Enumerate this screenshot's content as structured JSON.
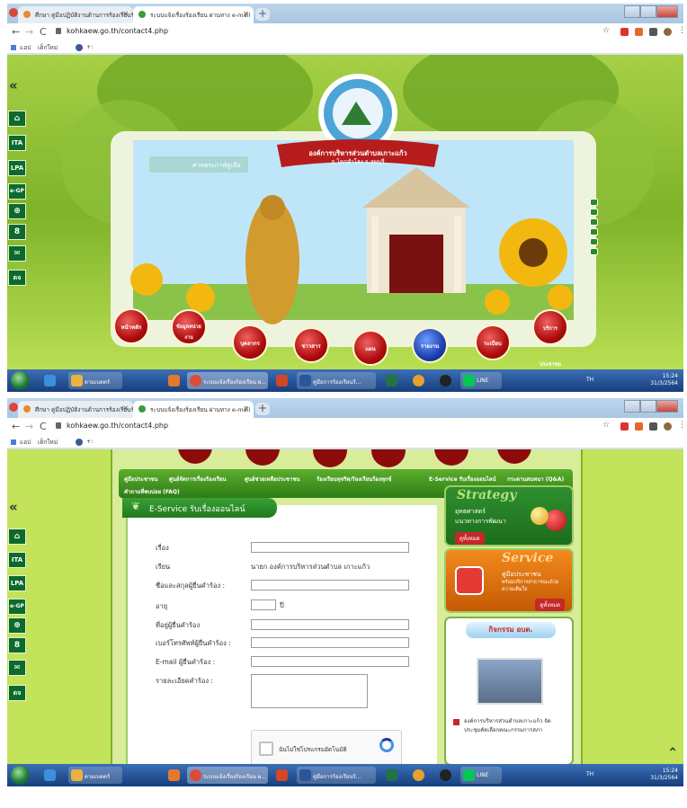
{
  "browser": {
    "tabs": [
      {
        "label": "ศึกษา คู่มือปฏิบัติงานด้านการร้องเรียนร้..."
      },
      {
        "label": "ระบบแจ้งเรื่องร้องเรียน ผ่านทาง e-mail"
      }
    ],
    "url1": "kohkaew.go.th/contact4.php",
    "url2": "kohkaew.go.th/contact4.php",
    "bookmarks": [
      "แอป",
      "เด็กใหม่",
      "+:"
    ]
  },
  "sidebar": {
    "collapse": "«",
    "items": [
      "⌂",
      "ITA",
      "LPA",
      "e-GP",
      "⊕",
      "8",
      "✉",
      "ดจ"
    ]
  },
  "header": {
    "org_name": "องค์การบริหารส่วนตำบลเกาะแก้ว",
    "district": "อ.โคกสำโรง จ.ลพบุรี",
    "marquee": "ศาลพระกาฬคู่เมือ"
  },
  "nav": {
    "items": [
      "หน้าหลัก",
      "ข้อมูลหน่วยงาน",
      "บุคลากร",
      "ข่าวสาร",
      "แผน",
      "รายงาน",
      "ระเบียบ",
      "บริการประชาชน"
    ]
  },
  "menu2": {
    "items": [
      "คู่มือประชาชน",
      "ศูนย์จัดการเรื่องร้องเรียน",
      "ศูนย์ช่วยเหลือประชาชน",
      "ร้องเรียนทุจริต/ร้องเรียนร้องทุกข์",
      "E-Service รับเรื่องออนไลน์",
      "กระดานสนทนา (Q&A)",
      "คำถามที่พบบ่อย (FAQ)"
    ]
  },
  "form": {
    "title": "E-Service รับเรื่องออนไลน์",
    "fields": {
      "subject": "เรื่อง",
      "to": "เรียน",
      "to_value": "นายก องค์การบริหารส่วนตำบล เกาะแก้ว",
      "name": "ชื่อและสกุลผู้ยื่นคำร้อง :",
      "age": "อายุ",
      "age_unit": "ปี",
      "address": "ที่อยู่ผู้ยื่นคำร้อง",
      "phone": "เบอร์โทรศัพท์ผู้ยื่นคำร้อง :",
      "email": "E-mail ผู้ยื่นคำร้อง :",
      "detail": "รายละเอียดคำร้อง :"
    },
    "captcha": "ฉันไม่ใช่โปรแกรมอัตโนมัติ"
  },
  "side": {
    "strategy_title": "Strategy",
    "strategy_text1": "ยุทธศาสตร์",
    "strategy_text2": "แนวทางการพัฒนา",
    "strategy_btn": "ดูทั้งหมด",
    "service_title": "Service",
    "service_text1": "คู่มือประชาชน",
    "service_text2": "พร้อมบริการสาธารณะด้วยความเต็มใจ",
    "service_btn": "ดูทั้งหมด",
    "activity_title": "กิจกรรม อบต.",
    "activity_text1": "องค์การบริหารส่วนตำบลเกาะแก้ว จัด",
    "activity_text2": "ประชุมคัดเลือกคณะกรรมการสภา"
  },
  "taskbar": {
    "lang": "TH",
    "time": "15:24",
    "date": "31/3/2564",
    "items": [
      "ตามเบดตร์",
      "ระบบแจ้งเรื่องร้องเรียน ผ...",
      "คู่มือการร้องเรียนร้...",
      "LINE"
    ]
  },
  "colors": {
    "accent": "#2e8a1e",
    "lime": "#c2e35a",
    "red": "#b00c0c"
  }
}
